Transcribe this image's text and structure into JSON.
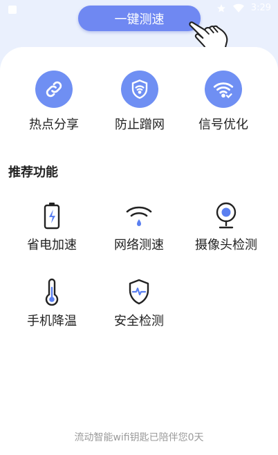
{
  "status_bar": {
    "time": "3:29"
  },
  "speed_button": {
    "label": "一键测速"
  },
  "quick_actions": [
    {
      "label": "热点分享",
      "icon": "link-icon"
    },
    {
      "label": "防止蹭网",
      "icon": "wifi-shield-icon"
    },
    {
      "label": "信号优化",
      "icon": "wifi-check-icon"
    }
  ],
  "recommended": {
    "title": "推荐功能",
    "items": [
      {
        "label": "省电加速",
        "icon": "battery-bolt-icon"
      },
      {
        "label": "网络测速",
        "icon": "wifi-speed-icon"
      },
      {
        "label": "摄像头检测",
        "icon": "camera-icon"
      },
      {
        "label": "手机降温",
        "icon": "thermometer-icon"
      },
      {
        "label": "安全检测",
        "icon": "shield-pulse-icon"
      }
    ]
  },
  "footer": {
    "text": "流动智能wifi钥匙已陪伴您0天"
  },
  "colors": {
    "accent": "#6f8ff3",
    "button": "#6f88f2",
    "background": "#eaf0fd"
  }
}
